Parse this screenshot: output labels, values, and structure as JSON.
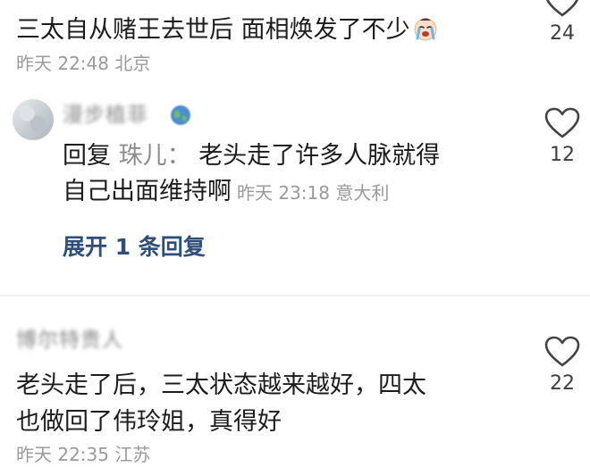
{
  "comment1": {
    "text": "三太自从赌王去世后 面相焕发了不少",
    "emoji": "crying-face-icon",
    "meta": "昨天 22:48 北京",
    "likes": "24"
  },
  "reply": {
    "username_blurred": "漫步植菲",
    "prefix": "回复",
    "reply_to": "珠儿：",
    "line1_text": "老头走了许多人脉就得",
    "line2_text": "自己出面维持啊",
    "meta": "昨天 23:18 意大利",
    "likes": "12",
    "expand_label": "展开 1 条回复"
  },
  "comment3": {
    "username_blurred": "博尔特贵人",
    "line1": "老头走了后，三太状态越来越好，四太",
    "line2": "也做回了伟玲姐，真得好",
    "meta": "昨天 22:35 江苏",
    "likes": "22"
  },
  "colors": {
    "text": "#1c1c1c",
    "meta": "#9a9a9a",
    "link": "#2f4f7a",
    "heart_stroke": "#444444"
  }
}
